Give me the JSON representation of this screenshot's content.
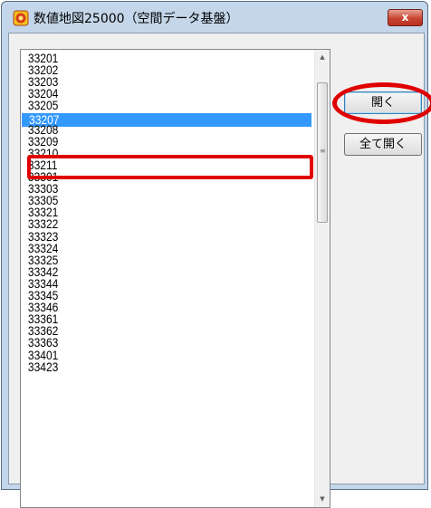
{
  "window": {
    "title": "数値地図25000（空間データ基盤）",
    "close_label": "x"
  },
  "list": {
    "items": [
      "33201",
      "33202",
      "33203",
      "33204",
      "33205",
      "33207",
      "33208",
      "33209",
      "33210",
      "33211",
      "33301",
      "33303",
      "33305",
      "33321",
      "33322",
      "33323",
      "33324",
      "33325",
      "33342",
      "33344",
      "33345",
      "33346",
      "33361",
      "33362",
      "33363",
      "33401",
      "33423"
    ],
    "selected": "33207"
  },
  "buttons": {
    "open": "開く",
    "open_all": "全て開く"
  },
  "scrollbar": {
    "up": "▲",
    "down": "▼",
    "grip": "≡"
  },
  "colors": {
    "selection": "#3399ff",
    "annotation": "#e00000"
  },
  "icons": {
    "app": "map-app-icon",
    "close": "close-icon"
  }
}
